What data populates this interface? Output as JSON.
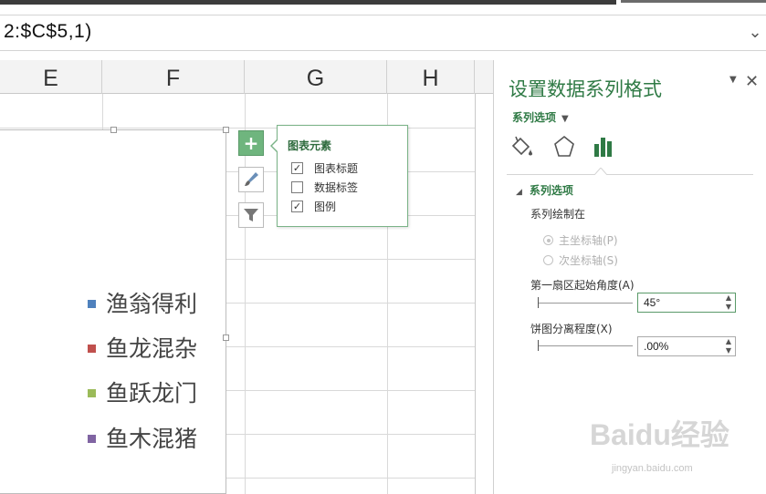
{
  "formula_bar": {
    "text": "2:$C$5,1)",
    "expand_icon": "chevron-down-icon"
  },
  "columns": [
    "E",
    "F",
    "G",
    "H"
  ],
  "legend": [
    {
      "label": "渔翁得利",
      "color": "#4f81bd"
    },
    {
      "label": "鱼龙混杂",
      "color": "#c0504d"
    },
    {
      "label": "鱼跃龙门",
      "color": "#9bbb59"
    },
    {
      "label": "鱼木混猪",
      "color": "#8064a2"
    }
  ],
  "chart_tools": {
    "add_element_icon": "plus-icon",
    "styles_icon": "paintbrush-icon",
    "filter_icon": "filter-icon"
  },
  "chart_elements_popup": {
    "title": "图表元素",
    "items": [
      {
        "label": "图表标题",
        "checked": true
      },
      {
        "label": "数据标签",
        "checked": false
      },
      {
        "label": "图例",
        "checked": true
      }
    ]
  },
  "format_pane": {
    "title": "设置数据系列格式",
    "series_dropdown": "系列选项",
    "tabs": [
      "fill-line-icon",
      "effects-icon",
      "series-options-icon"
    ],
    "section_title": "系列选项",
    "plot_on_label": "系列绘制在",
    "primary_axis": "主坐标轴(P)",
    "secondary_axis": "次坐标轴(S)",
    "first_slice_angle_label": "第一扇区起始角度(A)",
    "first_slice_angle_value": "45°",
    "explosion_label": "饼图分离程度(X)",
    "explosion_value": ".00%"
  },
  "watermark": {
    "brand": "Baidu经验",
    "url": "jingyan.baidu.com"
  }
}
